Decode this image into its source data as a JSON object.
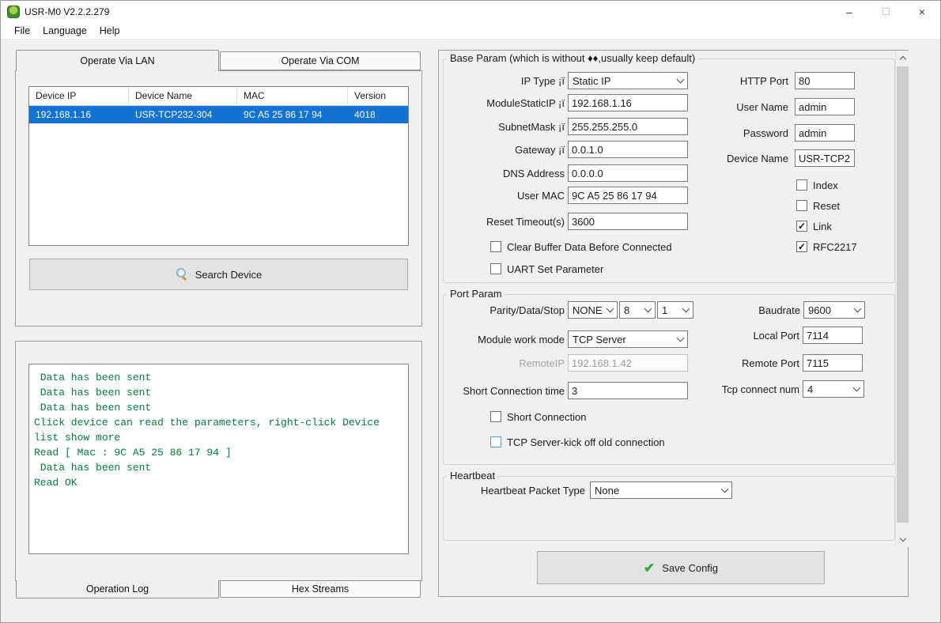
{
  "window": {
    "title": "USR-M0 V2.2.2.279",
    "minimize": "–",
    "close": "×"
  },
  "menu": {
    "file": "File",
    "language": "Language",
    "help": "Help"
  },
  "device_panel": {
    "tab_lan": "Operate Via LAN",
    "tab_com": "Operate Via COM",
    "table": {
      "columns": [
        "Device IP",
        "Device Name",
        "MAC",
        "Version"
      ],
      "selected_row": {
        "ip": "192.168.1.16",
        "name": "USR-TCP232-304",
        "mac": "9C A5 25 86 17 94",
        "version": "4018"
      }
    },
    "search_button": "Search Device"
  },
  "log_panel": {
    "lines": " Data has been sent\n Data has been sent\n Data has been sent\nClick device can read the parameters, right-click Device\nlist show more\nRead [ Mac : 9C A5 25 86 17 94 ]\n Data has been sent\nRead OK",
    "tab_operation_log": "Operation Log",
    "tab_hex_streams": "Hex Streams"
  },
  "base_param": {
    "legend": "Base Param (which is without ♦♦,usually keep default)",
    "ip_type": {
      "label": "IP Type ¡ï",
      "value": "Static IP"
    },
    "module_static_ip": {
      "label": "ModuleStaticIP ¡ï",
      "value": "192.168.1.16"
    },
    "subnet_mask": {
      "label": "SubnetMask ¡ï",
      "value": "255.255.255.0"
    },
    "gateway": {
      "label": "Gateway ¡ï",
      "value": "0.0.1.0"
    },
    "dns_address": {
      "label": "DNS Address",
      "value": "0.0.0.0"
    },
    "user_mac": {
      "label": "User MAC",
      "value": "9C A5 25 86 17 94"
    },
    "reset_timeout": {
      "label": "Reset Timeout(s)",
      "value": "3600"
    },
    "clear_buffer": {
      "label": "Clear Buffer Data Before Connected",
      "checked": false
    },
    "uart_set": {
      "label": "UART Set Parameter",
      "checked": false
    },
    "http_port": {
      "label": "HTTP Port",
      "value": "80"
    },
    "user_name": {
      "label": "User Name",
      "value": "admin"
    },
    "password": {
      "label": "Password",
      "value": "admin"
    },
    "device_name": {
      "label": "Device Name",
      "value": "USR-TCP2"
    },
    "index": {
      "label": "Index",
      "checked": false
    },
    "reset": {
      "label": "Reset",
      "checked": false
    },
    "link": {
      "label": "Link",
      "checked": true
    },
    "rfc2217": {
      "label": "RFC2217",
      "checked": true
    }
  },
  "port_param": {
    "legend": "Port Param",
    "parity_label": "Parity/Data/Stop",
    "parity": "NONE",
    "data_bits": "8",
    "stop_bits": "1",
    "work_mode": {
      "label": "Module work mode",
      "value": "TCP Server"
    },
    "remote_ip": {
      "label": "RemoteIP",
      "value": "192.168.1.42"
    },
    "short_time": {
      "label": "Short Connection time",
      "value": "3"
    },
    "short_conn": {
      "label": "Short Connection",
      "checked": false
    },
    "kick": {
      "label": "TCP Server-kick off old connection",
      "checked": false
    },
    "baudrate": {
      "label": "Baudrate",
      "value": "9600"
    },
    "local_port": {
      "label": "Local Port",
      "value": "7114"
    },
    "remote_port": {
      "label": "Remote Port",
      "value": "7115"
    },
    "tcp_num": {
      "label": "Tcp connect num",
      "value": "4"
    }
  },
  "heartbeat": {
    "legend": "Heartbeat",
    "packet_type": {
      "label": "Heartbeat Packet Type",
      "value": "None"
    }
  },
  "save_button": "Save Config",
  "colors": {
    "selection_blue": "#1373d4",
    "log_green": "#008040",
    "check_green": "#2fae3e"
  }
}
